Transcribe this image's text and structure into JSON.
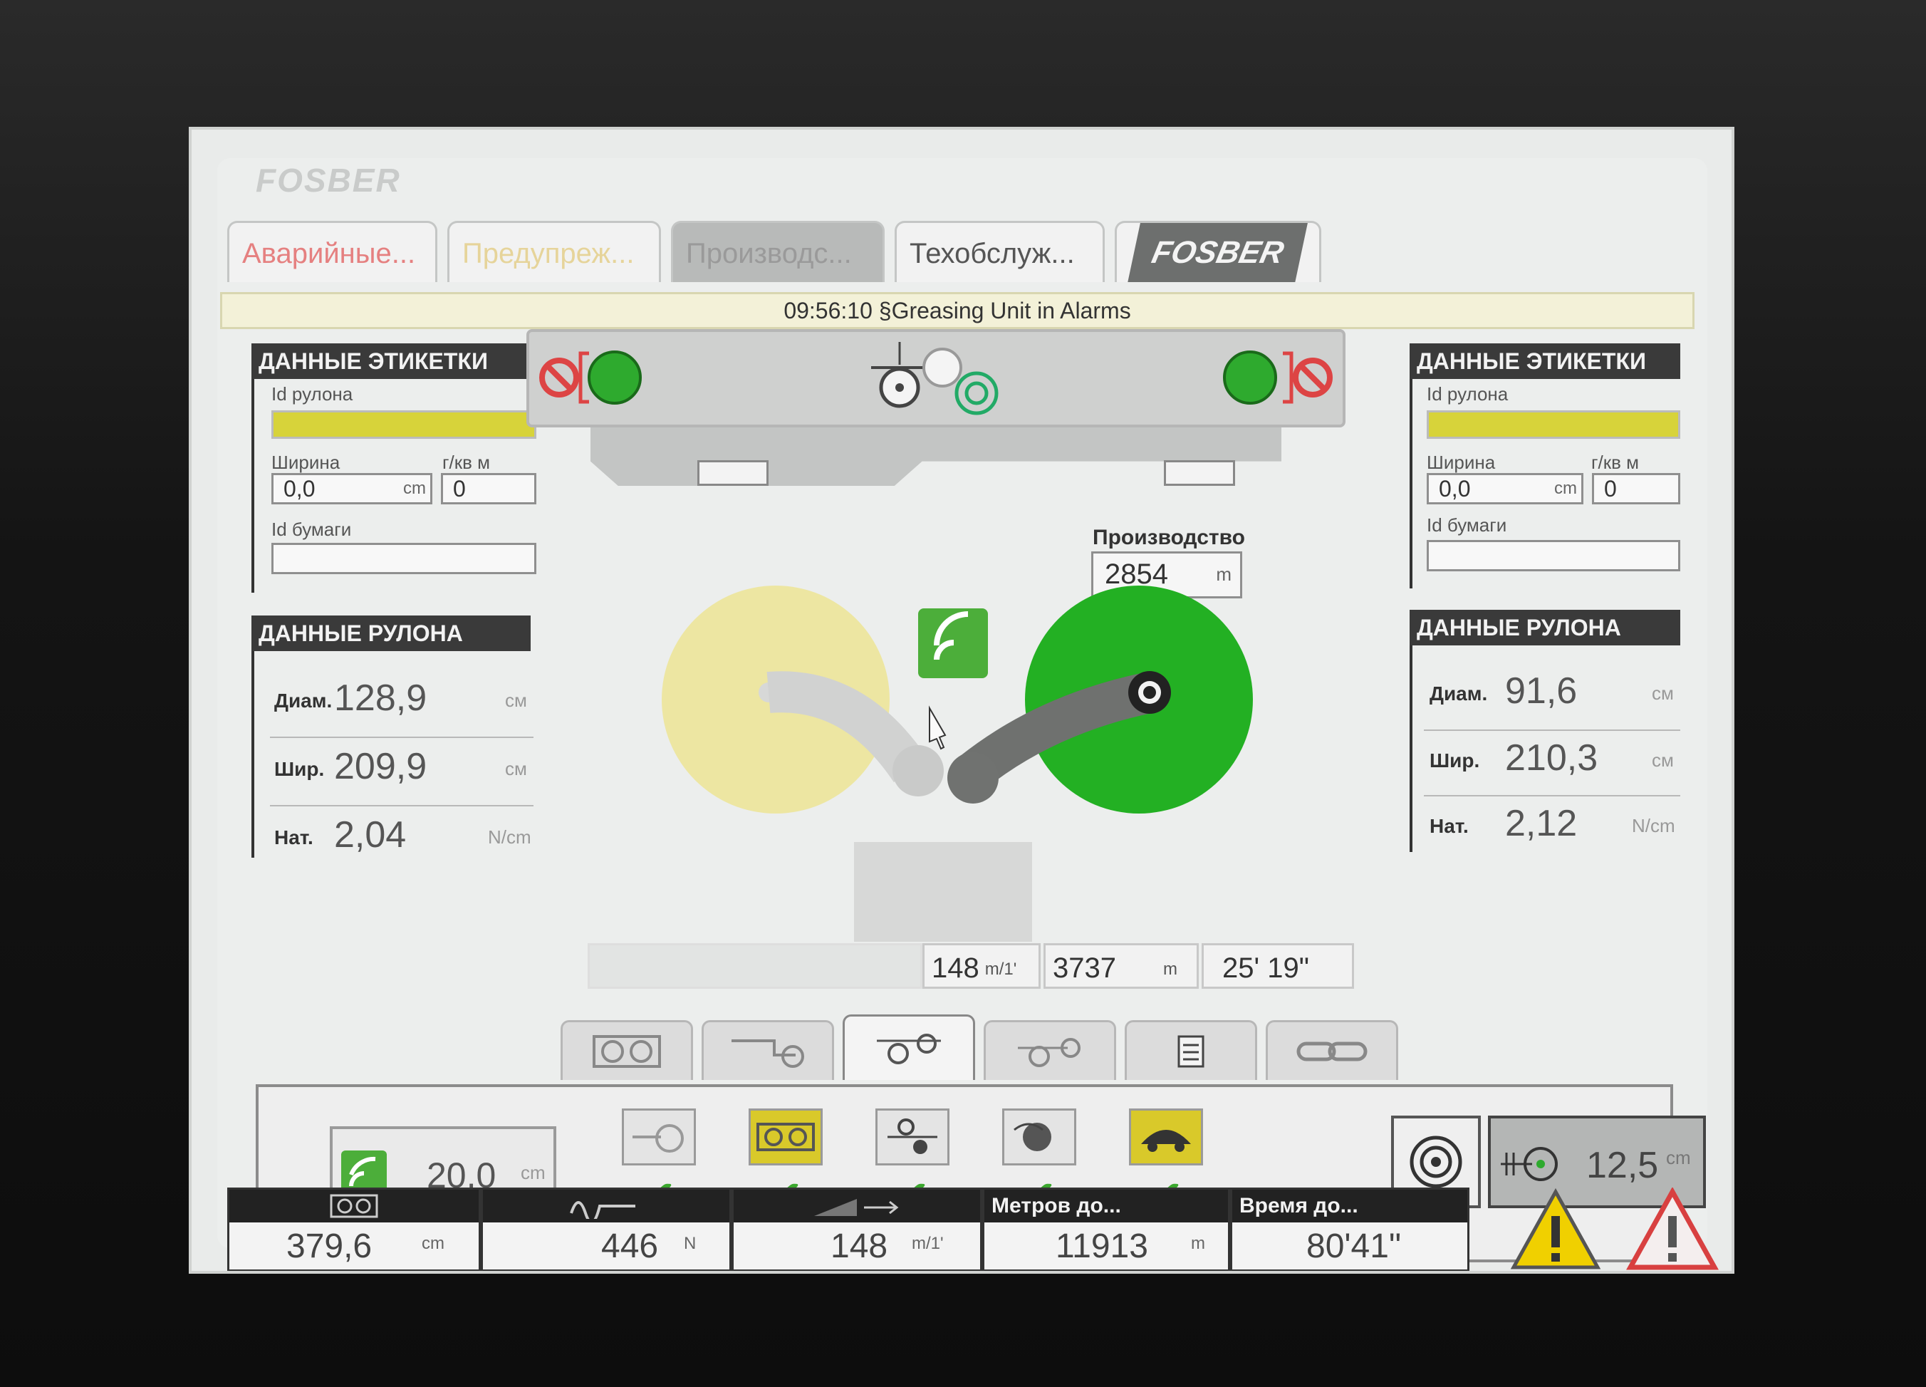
{
  "logo_top": "FOSBER",
  "tabs": [
    {
      "label": "Аварийные..."
    },
    {
      "label": "Предупреж..."
    },
    {
      "label": "Производс..."
    },
    {
      "label": "Техобслуж..."
    },
    {
      "label": "FOSBER"
    }
  ],
  "alarm_message": "09:56:10 §Greasing Unit in Alarms",
  "left_label_panel": {
    "title": "ДАННЫЕ ЭТИКЕТКИ",
    "roll_id_label": "Id рулона",
    "width_label": "Ширина",
    "width_value": "0,0",
    "width_unit": "cm",
    "gsm_label": "г/кв м",
    "gsm_value": "0",
    "paper_id_label": "Id бумаги",
    "paper_id_value": ""
  },
  "left_roll_panel": {
    "title": "ДАННЫЕ РУЛОНА",
    "rows": [
      {
        "label": "Диам.",
        "value": "128,9",
        "unit": "см"
      },
      {
        "label": "Шир.",
        "value": "209,9",
        "unit": "см"
      },
      {
        "label": "Нат.",
        "value": "2,04",
        "unit": "N/cm"
      }
    ]
  },
  "right_label_panel": {
    "title": "ДАННЫЕ ЭТИКЕТКИ",
    "roll_id_label": "Id рулона",
    "width_label": "Ширина",
    "width_value": "0,0",
    "width_unit": "cm",
    "gsm_label": "г/кв м",
    "gsm_value": "0",
    "paper_id_label": "Id бумаги",
    "paper_id_value": ""
  },
  "right_roll_panel": {
    "title": "ДАННЫЕ РУЛОНА",
    "rows": [
      {
        "label": "Диам.",
        "value": "91,6",
        "unit": "см"
      },
      {
        "label": "Шир.",
        "value": "210,3",
        "unit": "см"
      },
      {
        "label": "Нат.",
        "value": "2,12",
        "unit": "N/cm"
      }
    ]
  },
  "production": {
    "label": "Производство",
    "value": "2854",
    "unit": "m"
  },
  "status_strip": {
    "speed_value": "148",
    "speed_unit": "m/1'",
    "length_value": "3737",
    "length_unit": "m",
    "time_value": "25' 19\""
  },
  "lower_panel": {
    "feed_value": "20,0",
    "feed_unit": "cm",
    "dist_value": "12,5",
    "dist_unit": "cm",
    "checks": [
      "✔",
      "✔",
      "✔",
      "✔",
      "✔"
    ]
  },
  "bottom_bar": {
    "diameter_value": "379,6",
    "diameter_unit": "cm",
    "tension_value": "446",
    "tension_unit": "N",
    "speed_value": "148",
    "speed_unit": "m/1'",
    "meters_label": "Метров до...",
    "meters_value": "11913",
    "meters_unit": "m",
    "time_label": "Время до...",
    "time_value": "80'41\""
  },
  "colors": {
    "roll_left": "#ede6a2",
    "roll_right": "#23b023",
    "accent_green": "#2eaa2e",
    "label_yellow": "#d7d33a",
    "warning_yellow": "#f0d000",
    "alarm_red": "#d84040"
  }
}
